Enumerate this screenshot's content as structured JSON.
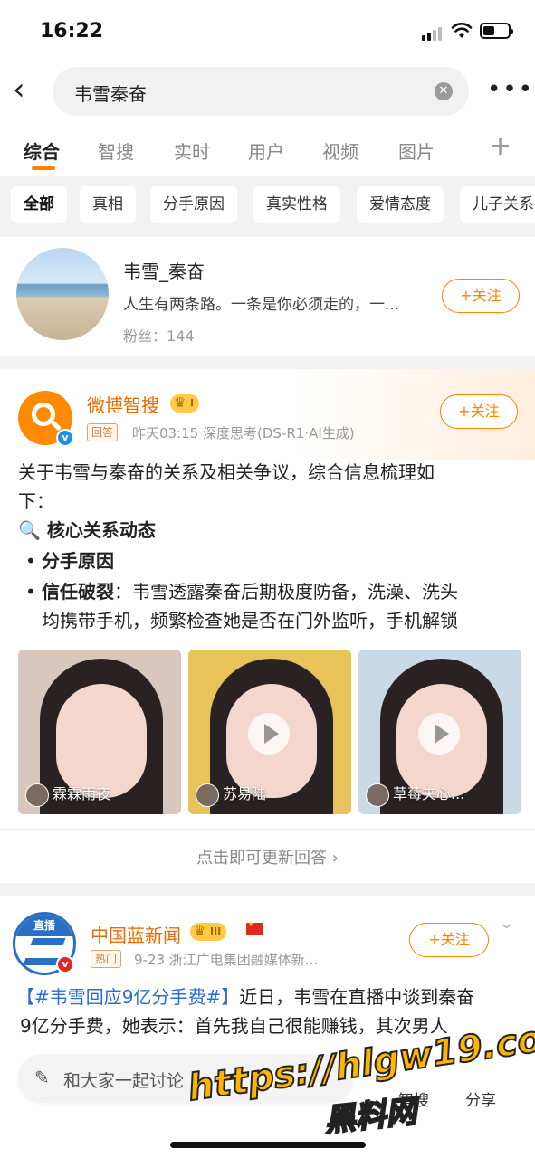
{
  "status_bar": {
    "time": "16:22"
  },
  "search": {
    "query": "韦雪秦奋"
  },
  "tabs": [
    {
      "label": "综合",
      "active": true
    },
    {
      "label": "智搜",
      "active": false
    },
    {
      "label": "实时",
      "active": false
    },
    {
      "label": "用户",
      "active": false
    },
    {
      "label": "视频",
      "active": false
    },
    {
      "label": "图片",
      "active": false
    }
  ],
  "tab_plus": "+",
  "chips": [
    "全部",
    "真相",
    "分手原因",
    "真实性格",
    "爱情态度",
    "儿子关系"
  ],
  "user_card": {
    "name": "韦雪_秦奋",
    "bio": "人生有两条路。一条是你必须走的，一...",
    "fans_label": "粉丝：",
    "fans_count": "144",
    "follow_label": "+关注"
  },
  "ai_card": {
    "name": "微博智搜",
    "level": "I",
    "tag": "回答",
    "meta": "昨天03:15  深度思考(DS-R1·AI生成)",
    "follow_label": "+关注",
    "intro_line1": "关于韦雪与秦奋的关系及相关争议，综合信息梳理如",
    "intro_line2": "下：",
    "heading_icon": "🔍",
    "heading": "核心关系动态",
    "bullet1": "分手原因",
    "bullet2_label": "信任破裂",
    "bullet2_text": "：韦雪透露秦奋后期极度防备，洗澡、洗头",
    "bullet2_line2": "均携带手机，频繁检查她是否在门外监听，手机解锁",
    "videos": [
      {
        "caption": "霖霖雨夜",
        "bg": "#d9c7bd",
        "has_play": false
      },
      {
        "caption": "苏易陆",
        "bg": "#e8c35a",
        "has_play": true
      },
      {
        "caption": "草莓夹心...",
        "bg": "#c9d9e6",
        "has_play": true
      }
    ],
    "refresh_label": "点击即可更新回答",
    "refresh_arrow": "›"
  },
  "news_card": {
    "logo_text": "直播",
    "name": "中国蓝新闻",
    "level": "III",
    "tag": "热门",
    "meta": "9-23  浙江广电集团融媒体新...",
    "follow_label": "+关注",
    "hashtag": "【#韦雪回应9亿分手费#】",
    "text_line1_rest": "近日，韦雪在直播中谈到秦奋",
    "text_line2": "9亿分手费，她表示：首先我自己很能赚钱，其次男人"
  },
  "bottom_bar": {
    "discuss_placeholder": "和大家一起讨论",
    "zhisou_label": "智搜",
    "share_label": "分享"
  },
  "watermark": {
    "line1": "https://hlgw19.com",
    "line2": "黑料网"
  },
  "colors": {
    "accent": "#ff8200",
    "name_orange": "#e86b00",
    "link_blue": "#2d6dd1",
    "verified_blue": "#1e8ef5"
  }
}
